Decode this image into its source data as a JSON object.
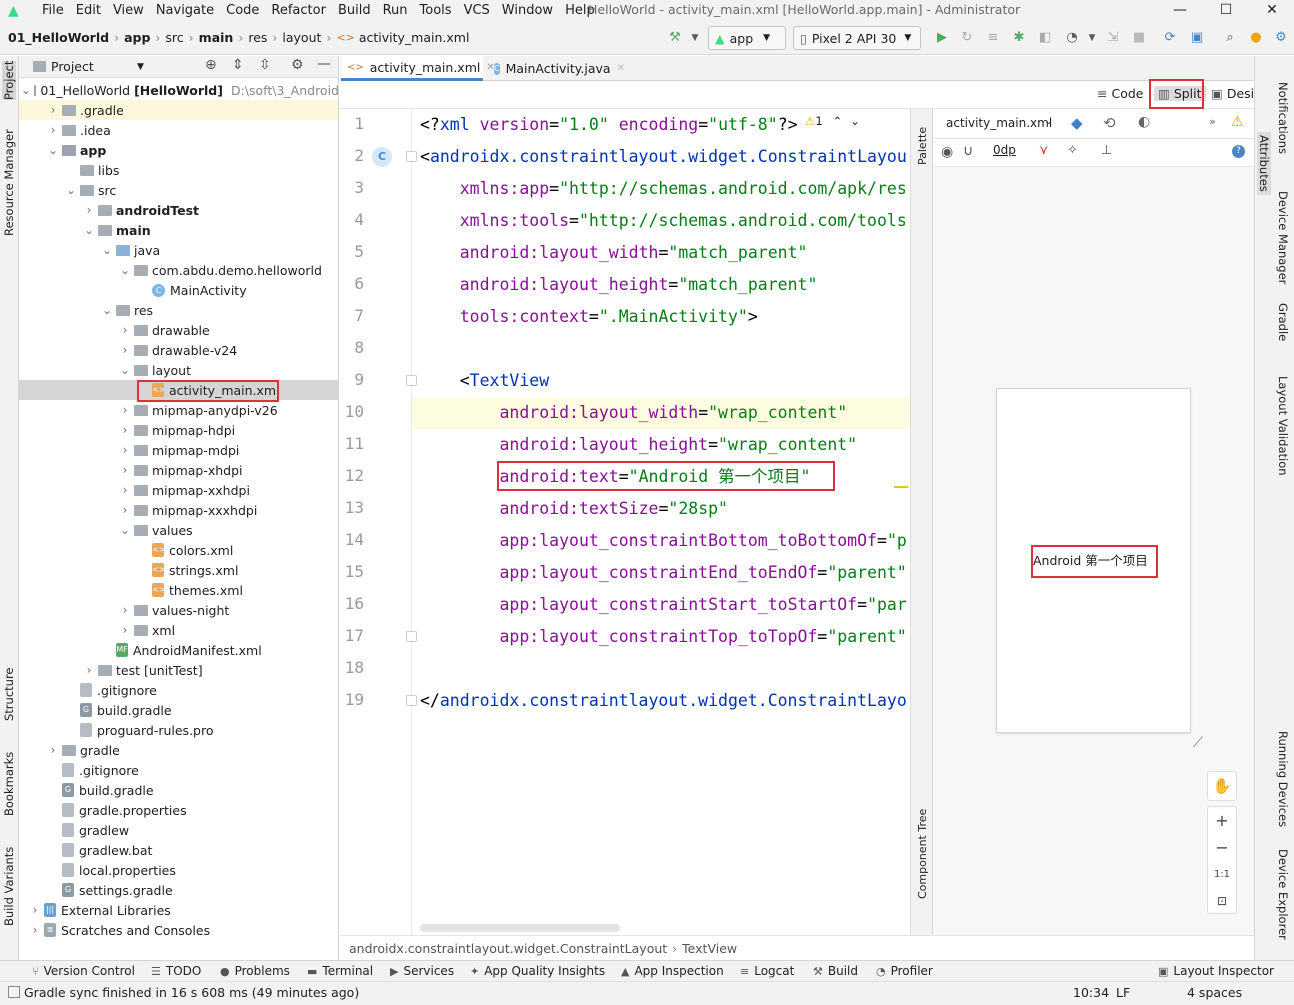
{
  "menu": {
    "items": [
      "File",
      "Edit",
      "View",
      "Navigate",
      "Code",
      "Refactor",
      "Build",
      "Run",
      "Tools",
      "VCS",
      "Window",
      "Help"
    ],
    "title": "HelloWorld - activity_main.xml [HelloWorld.app.main] - Administrator",
    "controls": {
      "minimize": "—",
      "maximize": "☐",
      "close": "✕"
    }
  },
  "navbar": {
    "crumbs": [
      "01_HelloWorld",
      "app",
      "src",
      "main",
      "res",
      "layout",
      "activity_main.xml"
    ],
    "run_config": "app",
    "device": "Pixel 2 API 30"
  },
  "project": {
    "header": "Project",
    "tree": [
      {
        "label": "01_HelloWorld",
        "suffix": "[HelloWorld]",
        "path": "D:\\soft\\3_Android",
        "indent": 0,
        "open": true,
        "icon": "mod"
      },
      {
        "label": ".gradle",
        "indent": 1,
        "open": false,
        "icon": "folder",
        "highlight": true
      },
      {
        "label": ".idea",
        "indent": 1,
        "open": false,
        "icon": "folder"
      },
      {
        "label": "app",
        "indent": 1,
        "open": true,
        "icon": "mod",
        "bold": true
      },
      {
        "label": "libs",
        "indent": 2,
        "icon": "folder",
        "leaf": true
      },
      {
        "label": "src",
        "indent": 2,
        "open": true,
        "icon": "folder"
      },
      {
        "label": "androidTest",
        "indent": 3,
        "open": false,
        "icon": "folder",
        "bold": true
      },
      {
        "label": "main",
        "indent": 3,
        "open": true,
        "icon": "folder",
        "bold": true
      },
      {
        "label": "java",
        "indent": 4,
        "open": true,
        "icon": "blue"
      },
      {
        "label": "com.abdu.demo.helloworld",
        "indent": 5,
        "open": true,
        "icon": "folder"
      },
      {
        "label": "MainActivity",
        "indent": 6,
        "icon": "class",
        "leaf": true
      },
      {
        "label": "res",
        "indent": 4,
        "open": true,
        "icon": "folder"
      },
      {
        "label": "drawable",
        "indent": 5,
        "open": false,
        "icon": "folder"
      },
      {
        "label": "drawable-v24",
        "indent": 5,
        "open": false,
        "icon": "folder"
      },
      {
        "label": "layout",
        "indent": 5,
        "open": true,
        "icon": "folder"
      },
      {
        "label": "activity_main.xml",
        "indent": 6,
        "icon": "xml",
        "leaf": true,
        "selected": true
      },
      {
        "label": "mipmap-anydpi-v26",
        "indent": 5,
        "open": false,
        "icon": "folder"
      },
      {
        "label": "mipmap-hdpi",
        "indent": 5,
        "open": false,
        "icon": "folder"
      },
      {
        "label": "mipmap-mdpi",
        "indent": 5,
        "open": false,
        "icon": "folder"
      },
      {
        "label": "mipmap-xhdpi",
        "indent": 5,
        "open": false,
        "icon": "folder"
      },
      {
        "label": "mipmap-xxhdpi",
        "indent": 5,
        "open": false,
        "icon": "folder"
      },
      {
        "label": "mipmap-xxxhdpi",
        "indent": 5,
        "open": false,
        "icon": "folder"
      },
      {
        "label": "values",
        "indent": 5,
        "open": true,
        "icon": "folder"
      },
      {
        "label": "colors.xml",
        "indent": 6,
        "icon": "xml",
        "leaf": true
      },
      {
        "label": "strings.xml",
        "indent": 6,
        "icon": "xml",
        "leaf": true
      },
      {
        "label": "themes.xml",
        "indent": 6,
        "icon": "xml",
        "leaf": true
      },
      {
        "label": "values-night",
        "indent": 5,
        "open": false,
        "icon": "folder"
      },
      {
        "label": "xml",
        "indent": 5,
        "open": false,
        "icon": "folder"
      },
      {
        "label": "AndroidManifest.xml",
        "indent": 4,
        "icon": "mf",
        "leaf": true
      },
      {
        "label": "test [unitTest]",
        "indent": 3,
        "open": false,
        "icon": "folder"
      },
      {
        "label": ".gitignore",
        "indent": 2,
        "icon": "file",
        "leaf": true
      },
      {
        "label": "build.gradle",
        "indent": 2,
        "icon": "gradle",
        "leaf": true
      },
      {
        "label": "proguard-rules.pro",
        "indent": 2,
        "icon": "file",
        "leaf": true
      },
      {
        "label": "gradle",
        "indent": 1,
        "open": false,
        "icon": "folder"
      },
      {
        "label": ".gitignore",
        "indent": 1,
        "icon": "file",
        "leaf": true
      },
      {
        "label": "build.gradle",
        "indent": 1,
        "icon": "gradle",
        "leaf": true
      },
      {
        "label": "gradle.properties",
        "indent": 1,
        "icon": "file",
        "leaf": true
      },
      {
        "label": "gradlew",
        "indent": 1,
        "icon": "file",
        "leaf": true
      },
      {
        "label": "gradlew.bat",
        "indent": 1,
        "icon": "file",
        "leaf": true
      },
      {
        "label": "local.properties",
        "indent": 1,
        "icon": "file",
        "leaf": true
      },
      {
        "label": "settings.gradle",
        "indent": 1,
        "icon": "gradle",
        "leaf": true
      },
      {
        "label": "External Libraries",
        "indent": 0,
        "open": false,
        "icon": "lib"
      },
      {
        "label": "Scratches and Consoles",
        "indent": 0,
        "open": false,
        "icon": "scratch"
      }
    ]
  },
  "left_strip": {
    "project": "Project",
    "resource_manager": "Resource Manager",
    "structure": "Structure",
    "bookmarks": "Bookmarks",
    "build_variants": "Build Variants"
  },
  "editor": {
    "tabs": [
      "activity_main.xml",
      "MainActivity.java"
    ],
    "modes": {
      "code": "Code",
      "split": "Split",
      "design": "Design"
    },
    "warning_count": "1",
    "lines": [
      [
        [
          "pu",
          "<?"
        ],
        [
          "tg",
          "xml "
        ],
        [
          "at",
          "version"
        ],
        [
          "pu",
          "="
        ],
        [
          "sv",
          "\"1.0\" "
        ],
        [
          "at",
          "encoding"
        ],
        [
          "pu",
          "="
        ],
        [
          "sv",
          "\"utf-8\""
        ],
        [
          "pu",
          "?>"
        ]
      ],
      [
        [
          "pu",
          "<"
        ],
        [
          "tg",
          "androidx.constraintlayout.widget.ConstraintLayou"
        ]
      ],
      [
        [
          "pu",
          "    "
        ],
        [
          "ns",
          "xmlns:app"
        ],
        [
          "pu",
          "="
        ],
        [
          "sv",
          "\"http://schemas.android.com/apk/res"
        ]
      ],
      [
        [
          "pu",
          "    "
        ],
        [
          "ns",
          "xmlns:tools"
        ],
        [
          "pu",
          "="
        ],
        [
          "sv",
          "\"http://schemas.android.com/tools"
        ]
      ],
      [
        [
          "pu",
          "    "
        ],
        [
          "ns",
          "android:"
        ],
        [
          "at",
          "layout_width"
        ],
        [
          "pu",
          "="
        ],
        [
          "sv",
          "\"match_parent\""
        ]
      ],
      [
        [
          "pu",
          "    "
        ],
        [
          "ns",
          "android:"
        ],
        [
          "at",
          "layout_height"
        ],
        [
          "pu",
          "="
        ],
        [
          "sv",
          "\"match_parent\""
        ]
      ],
      [
        [
          "pu",
          "    "
        ],
        [
          "ns",
          "tools:"
        ],
        [
          "at",
          "context"
        ],
        [
          "pu",
          "="
        ],
        [
          "sv",
          "\".MainActivity\""
        ],
        [
          "pu",
          ">"
        ]
      ],
      [
        [
          "pu",
          ""
        ]
      ],
      [
        [
          "pu",
          "    <"
        ],
        [
          "tg",
          "TextView"
        ]
      ],
      [
        [
          "pu",
          "        "
        ],
        [
          "ns",
          "android:"
        ],
        [
          "at",
          "layout_width"
        ],
        [
          "pu",
          "="
        ],
        [
          "sv",
          "\"wrap_content\""
        ]
      ],
      [
        [
          "pu",
          "        "
        ],
        [
          "ns",
          "android:"
        ],
        [
          "at",
          "layout_height"
        ],
        [
          "pu",
          "="
        ],
        [
          "sv",
          "\"wrap_content\""
        ]
      ],
      [
        [
          "pu",
          "        "
        ],
        [
          "ns",
          "android:"
        ],
        [
          "at",
          "text"
        ],
        [
          "pu",
          "="
        ],
        [
          "sv",
          "\"Android 第一个项目\""
        ]
      ],
      [
        [
          "pu",
          "        "
        ],
        [
          "ns",
          "android:"
        ],
        [
          "at",
          "textSize"
        ],
        [
          "pu",
          "="
        ],
        [
          "sv",
          "\"28sp\""
        ]
      ],
      [
        [
          "pu",
          "        "
        ],
        [
          "ns",
          "app:"
        ],
        [
          "at",
          "layout_constraintBottom_toBottomOf"
        ],
        [
          "pu",
          "="
        ],
        [
          "sv",
          "\"p"
        ]
      ],
      [
        [
          "pu",
          "        "
        ],
        [
          "ns",
          "app:"
        ],
        [
          "at",
          "layout_constraintEnd_toEndOf"
        ],
        [
          "pu",
          "="
        ],
        [
          "sv",
          "\"parent\""
        ]
      ],
      [
        [
          "pu",
          "        "
        ],
        [
          "ns",
          "app:"
        ],
        [
          "at",
          "layout_constraintStart_toStartOf"
        ],
        [
          "pu",
          "="
        ],
        [
          "sv",
          "\"par"
        ]
      ],
      [
        [
          "pu",
          "        "
        ],
        [
          "ns",
          "app:"
        ],
        [
          "at",
          "layout_constraintTop_toTopOf"
        ],
        [
          "pu",
          "="
        ],
        [
          "sv",
          "\"parent\""
        ]
      ],
      [
        [
          "pu",
          ""
        ]
      ],
      [
        [
          "pu",
          "</"
        ],
        [
          "tg",
          "androidx.constraintlayout.widget.ConstraintLayo"
        ]
      ]
    ],
    "breadcrumb": [
      "androidx.constraintlayout.widget.ConstraintLayout",
      "TextView"
    ]
  },
  "preview": {
    "file": "activity_main.xml",
    "margin": "0dp",
    "text": "Android 第一个项目",
    "palette": "Palette",
    "component_tree": "Component Tree",
    "zoom_fit": "1:1"
  },
  "right_strip": {
    "notifications": "Notifications",
    "attributes": "Attributes",
    "device_manager": "Device Manager",
    "gradle": "Gradle",
    "layout_validation": "Layout Validation",
    "running_devices": "Running Devices",
    "device_explorer": "Device Explorer"
  },
  "toolwindows": [
    "Version Control",
    "TODO",
    "Problems",
    "Terminal",
    "Services",
    "App Quality Insights",
    "App Inspection",
    "Logcat",
    "Build",
    "Profiler",
    "Layout Inspector"
  ],
  "status": {
    "message": "Gradle sync finished in 16 s 608 ms (49 minutes ago)",
    "time": "10:34",
    "encoding": "LF",
    "indent": "4 spaces"
  }
}
